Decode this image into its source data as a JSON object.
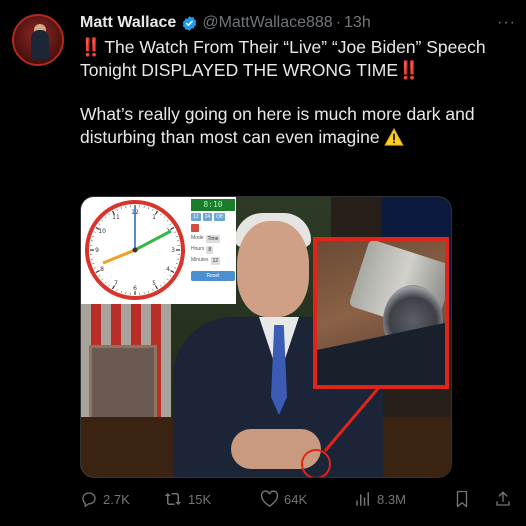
{
  "tweet": {
    "author_name": "Matt Wallace",
    "handle": "@MattWallace888",
    "separator": "·",
    "time": "13h",
    "more_label": "···",
    "line1_pre": "‼️",
    "line1_text": " The Watch From Their “Live” “Joe Biden” Speech Tonight DISPLAYED THE WRONG TIME",
    "line1_post": "‼️",
    "paragraph2": "What’s really going on here is much more dark and disturbing than most can even imagine "
  },
  "media": {
    "clock_digital": "8:10",
    "timer_labels": {
      "t12": "12",
      "t24": "24",
      "off": "Off",
      "mode": "Mode",
      "time": "Time",
      "hours": "Hours",
      "hours_val": "8",
      "minutes": "Minutes",
      "minutes_val": "12",
      "reset": "Reset"
    },
    "clock_numbers": [
      "12",
      "1",
      "2",
      "3",
      "4",
      "5",
      "6",
      "7",
      "8",
      "9",
      "10",
      "11"
    ]
  },
  "actions": {
    "replies": "2.7K",
    "reposts": "15K",
    "likes": "64K",
    "views": "8.3M"
  },
  "colors": {
    "accent_red": "#e0241a",
    "verified_blue": "#1d9bf0",
    "muted": "#71767b"
  }
}
